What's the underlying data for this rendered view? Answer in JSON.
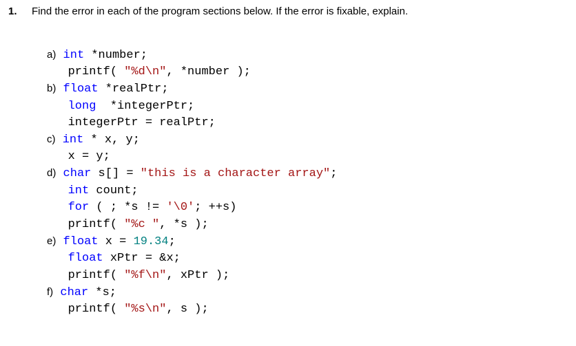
{
  "question": {
    "number": "1.",
    "text": "Find the error in each of the program sections below. If the error is fixable, explain."
  },
  "parts": {
    "a": {
      "label": "a)",
      "l1_int": "int",
      "l1_rest": " *number;",
      "l2_printf": "printf( ",
      "l2_str": "\"%d\\n\"",
      "l2_rest": ", *number );"
    },
    "b": {
      "label": "b)",
      "l1_float": "float",
      "l1_rest": " *realPtr;",
      "l2_long": "long",
      "l2_rest": "  *integerPtr;",
      "l3": "integerPtr = realPtr;"
    },
    "c": {
      "label": "c)",
      "l1_int": "int",
      "l1_rest": " * x, y;",
      "l2": "x = y;"
    },
    "d": {
      "label": "d)",
      "l1_char": "char",
      "l1_mid": " s[] = ",
      "l1_str": "\"this is a character array\"",
      "l1_end": ";",
      "l2_int": "int",
      "l2_rest": " count;",
      "l3_for": "for",
      "l3_mid": " ( ; *s != ",
      "l3_chr": "'\\0'",
      "l3_end": "; ++s)",
      "l4_printf": "printf( ",
      "l4_str": "\"%c \"",
      "l4_rest": ", *s );"
    },
    "e": {
      "label": "e)",
      "l1_float": "float",
      "l1_mid": " x = ",
      "l1_num": "19.34",
      "l1_end": ";",
      "l2_float": "float",
      "l2_rest": " xPtr = &x;",
      "l3_printf": "printf( ",
      "l3_str": "\"%f\\n\"",
      "l3_rest": ", xPtr );"
    },
    "f": {
      "label": "f)",
      "l1_char": "char",
      "l1_rest": " *s;",
      "l2_printf": "printf( ",
      "l2_str": "\"%s\\n\"",
      "l2_rest": ", s );"
    }
  }
}
